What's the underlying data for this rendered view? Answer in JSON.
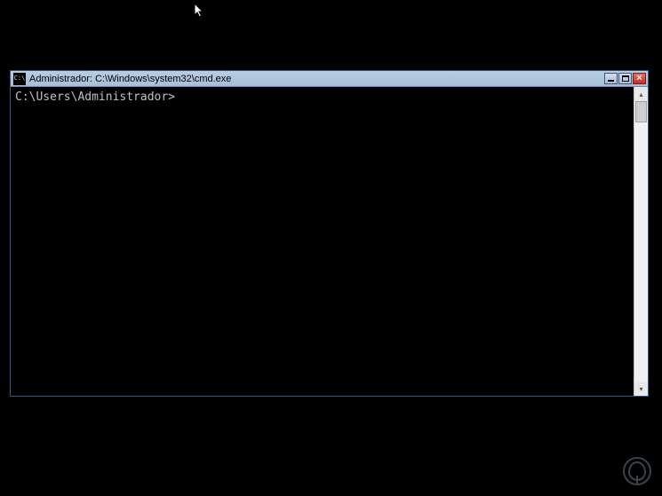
{
  "titlebar": {
    "icon_label": "C:\\",
    "title": "Administrador: C:\\Windows\\system32\\cmd.exe"
  },
  "controls": {
    "minimize": "_",
    "maximize": "□",
    "close": "×"
  },
  "terminal": {
    "prompt": "C:\\Users\\Administrador>"
  },
  "scrollbar": {
    "up": "▴",
    "down": "▾"
  }
}
